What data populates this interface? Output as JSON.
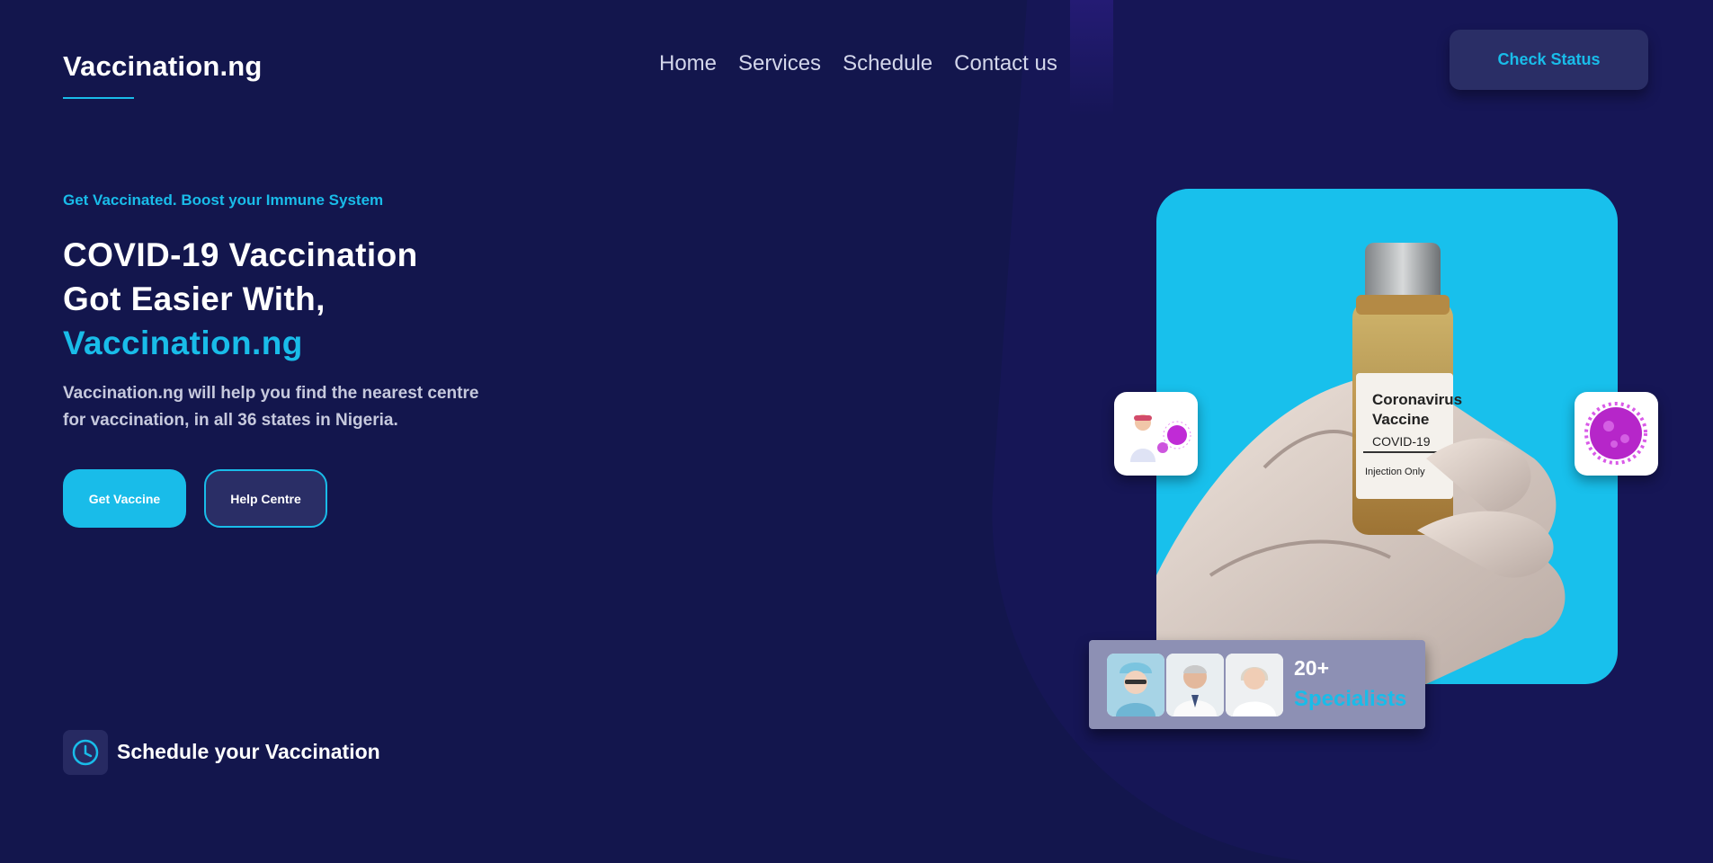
{
  "header": {
    "logo": "Vaccination.ng",
    "nav": [
      "Home",
      "Services",
      "Schedule",
      "Contact us"
    ],
    "check_status": "Check Status"
  },
  "hero": {
    "subtitle": "Get Vaccinated. Boost your Immune System",
    "title_line1": "COVID-19 Vaccination",
    "title_line2": "Got Easier With,",
    "title_line3": "Vaccination.ng",
    "description": "Vaccination.ng will help you find the nearest centre for vaccination, in all 36 states in Nigeria.",
    "primary_button": "Get Vaccine",
    "secondary_button": "Help Centre"
  },
  "vial_label": {
    "line1": "Coronavirus",
    "line2": "Vaccine",
    "line3": "COVID-19",
    "line4": "Injection Only"
  },
  "specialists": {
    "count": "20+",
    "label": "Specialists"
  },
  "schedule": {
    "label": "Schedule your Vaccination"
  },
  "colors": {
    "background": "#13164d",
    "accent": "#19bce9",
    "button_dark": "#2a2e66"
  }
}
